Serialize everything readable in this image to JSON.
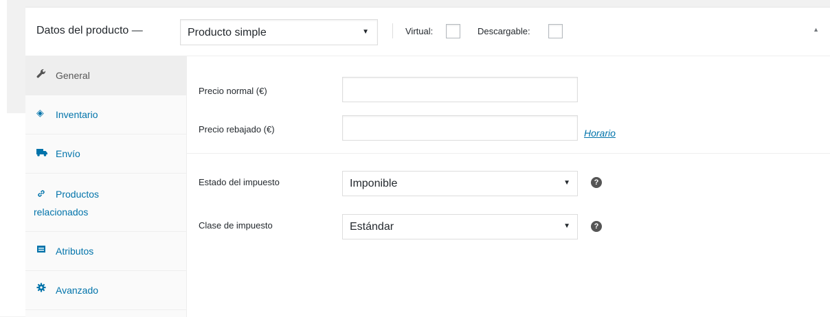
{
  "header": {
    "title": "Datos del producto —",
    "product_type": {
      "selected": "Producto simple",
      "arrow": "▼"
    },
    "virtual_label": "Virtual:",
    "virtual_checked": false,
    "downloadable_label": "Descargable:",
    "downloadable_checked": false,
    "collapse_icon": "▲"
  },
  "tabs": [
    {
      "icon": "wrench-icon",
      "glyph": "🔧",
      "label": "General",
      "active": true
    },
    {
      "icon": "tag-icon",
      "glyph": "◈",
      "label": "Inventario",
      "active": false
    },
    {
      "icon": "truck-icon",
      "glyph": "■",
      "label": "Envío",
      "active": false
    },
    {
      "icon": "link-icon",
      "glyph": "🔗",
      "label": "Productos",
      "label2": "relacionados",
      "active": false
    },
    {
      "icon": "list-icon",
      "glyph": "▤",
      "label": "Atributos",
      "active": false
    },
    {
      "icon": "gear-icon",
      "glyph": "✱",
      "label": "Avanzado",
      "active": false
    }
  ],
  "general": {
    "regular_price": {
      "label": "Precio normal (€)",
      "value": ""
    },
    "sale_price": {
      "label": "Precio rebajado (€)",
      "value": "",
      "schedule_link": "Horario"
    },
    "tax_status": {
      "label": "Estado del impuesto",
      "selected": "Imponible",
      "arrow": "▼",
      "help": "?"
    },
    "tax_class": {
      "label": "Clase de impuesto",
      "selected": "Estándar",
      "arrow": "▼",
      "help": "?"
    }
  },
  "colors": {
    "link": "#0073aa",
    "active_tab_bg": "#eeeeee",
    "tabs_bg": "#fafafa"
  }
}
